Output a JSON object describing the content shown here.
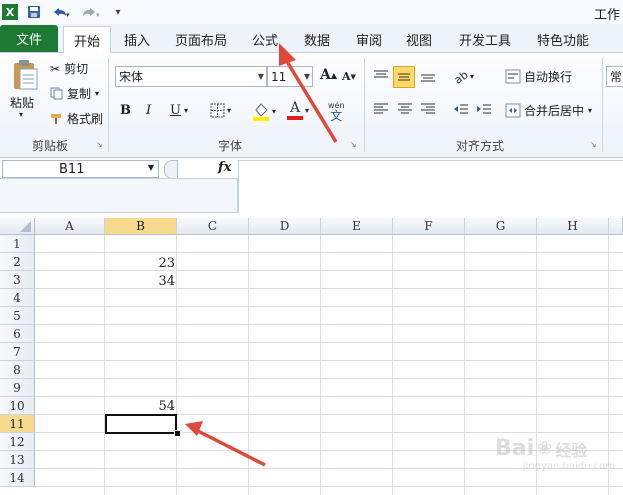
{
  "window": {
    "title": "工作"
  },
  "ribbon_tabs": [
    "文件",
    "开始",
    "插入",
    "页面布局",
    "公式",
    "数据",
    "审阅",
    "视图",
    "开发工具",
    "特色功能"
  ],
  "clipboard": {
    "paste": "粘贴",
    "cut": "剪切",
    "copy": "复制",
    "format_painter": "格式刷",
    "group": "剪贴板"
  },
  "font": {
    "name": "宋体",
    "size": "11",
    "bold": "B",
    "italic": "I",
    "underline": "U",
    "color_letter": "A",
    "group": "字体",
    "grow": "A",
    "shrink": "A",
    "phonetic": "文"
  },
  "alignment": {
    "wrap": "自动换行",
    "merge": "合并后居中",
    "group": "对齐方式"
  },
  "number": {
    "format": "常"
  },
  "formula_bar": {
    "name_box": "B11",
    "fx": "fx",
    "content": ""
  },
  "columns": [
    "A",
    "B",
    "C",
    "D",
    "E",
    "F",
    "G",
    "H"
  ],
  "rows": [
    "1",
    "2",
    "3",
    "4",
    "5",
    "6",
    "7",
    "8",
    "9",
    "10",
    "11",
    "12",
    "13",
    "14"
  ],
  "cells": {
    "B2": "23",
    "B3": "34",
    "B10": "54"
  },
  "selected_cell": "B11",
  "watermark": {
    "text": "Bai",
    "sub": "经验",
    "url": "jingyan.baidu.com"
  },
  "colors": {
    "file_tab": "#1d7a34",
    "arrow": "#e0483c",
    "selection_header": "#f7d98f"
  }
}
